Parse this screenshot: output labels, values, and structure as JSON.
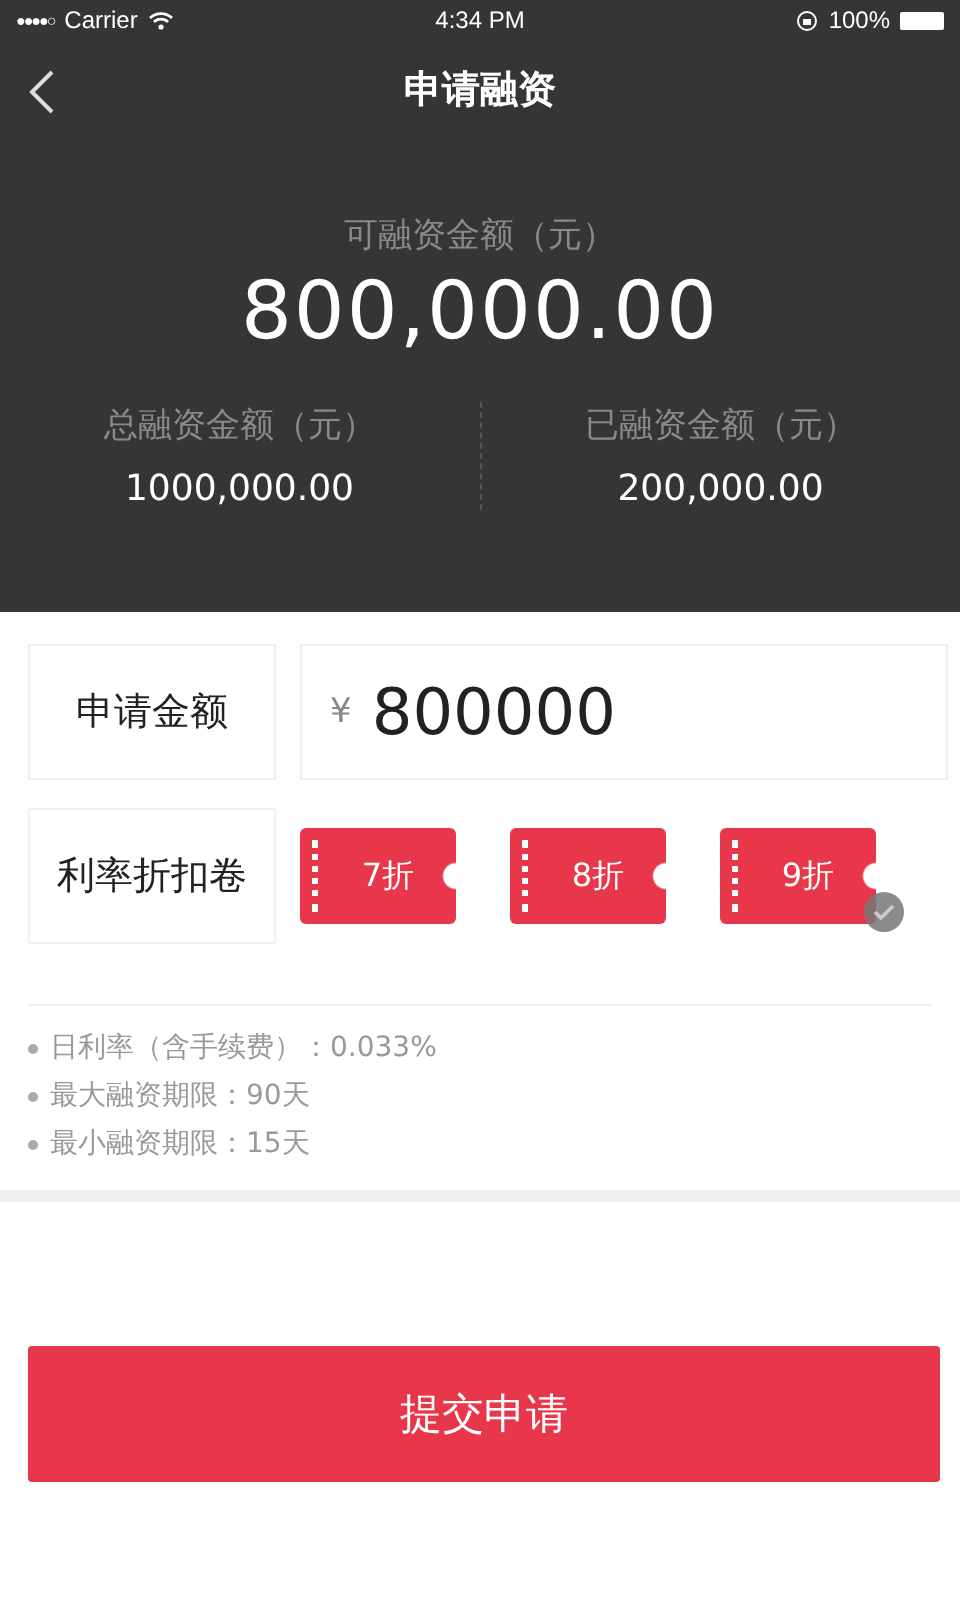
{
  "status_bar": {
    "signal": "●●●●○",
    "carrier": "Carrier",
    "time": "4:34 PM",
    "battery": "100%"
  },
  "nav": {
    "title": "申请融资"
  },
  "summary": {
    "available_label": "可融资金额（元）",
    "available_value": "800,000.00",
    "stats": [
      {
        "label": "总融资金额（元）",
        "value": "1000,000.00"
      },
      {
        "label": "已融资金额（元）",
        "value": "200,000.00"
      }
    ]
  },
  "amount": {
    "label": "申请金额",
    "currency": "¥",
    "value": "800000"
  },
  "coupons": {
    "label": "利率折扣卷",
    "items": [
      {
        "text": "7折",
        "selected": false
      },
      {
        "text": "8折",
        "selected": false
      },
      {
        "text": "9折",
        "selected": true
      }
    ]
  },
  "notes": [
    "日利率（含手续费）：0.033%",
    "最大融资期限：90天",
    "最小融资期限：15天"
  ],
  "submit": "提交申请"
}
